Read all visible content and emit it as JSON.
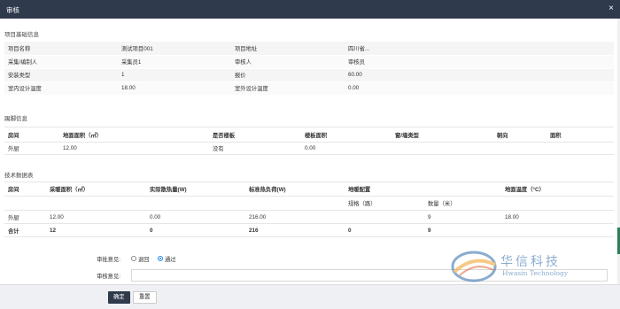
{
  "window": {
    "title": "审核",
    "close_glyph": "×"
  },
  "basic": {
    "section_title": "项目基础信息",
    "rows": [
      [
        "项目名称",
        "测试项目001",
        "项目地址",
        "四川省..."
      ],
      [
        "采集/编制人",
        "采集员1",
        "审核人",
        "审核员"
      ],
      [
        "安装类型",
        "1",
        "报价",
        "60.00"
      ],
      [
        "室内设计温度",
        "18.00",
        "室外设计温度",
        "0.00"
      ]
    ]
  },
  "room": {
    "section_title": "踢脚信息",
    "headers": [
      "房间",
      "地面面积（㎡）",
      "是否楼板",
      "楼板面积",
      "窗/墙类型",
      "朝向",
      "面积"
    ],
    "rows": [
      [
        "外厨",
        "12.00",
        "没有",
        "0.00",
        "",
        "",
        ""
      ]
    ]
  },
  "tech": {
    "section_title": "技术数据表",
    "headers": [
      "房间",
      "采暖面积（㎡）",
      "实际散热量(W)",
      "标准热负荷(W)",
      "地暖配置",
      "",
      "地面温度（°C）"
    ],
    "sub_headers": [
      "",
      "",
      "",
      "",
      "规格（路）",
      "数量（米）",
      ""
    ],
    "rows": [
      [
        "外厨",
        "12.00",
        "0.00",
        "216.00",
        "",
        "9",
        "18.00"
      ]
    ],
    "total": [
      "合计",
      "12",
      "0",
      "216",
      "0",
      "9",
      ""
    ]
  },
  "review": {
    "opinion_label": "审批意见:",
    "option_reject": "退回",
    "option_pass": "通过",
    "selected": "通过",
    "comment_label": "审核意见:",
    "comment_value": ""
  },
  "footer": {
    "confirm_label": "确定",
    "reset_label": "重置"
  },
  "watermark": {
    "cn": "华信科技",
    "en": "Hwasin Technology"
  },
  "colors": {
    "titlebar": "#2f3a4c",
    "accent": "#1e88e5",
    "scroll_thumb": "#2e7d5b"
  }
}
